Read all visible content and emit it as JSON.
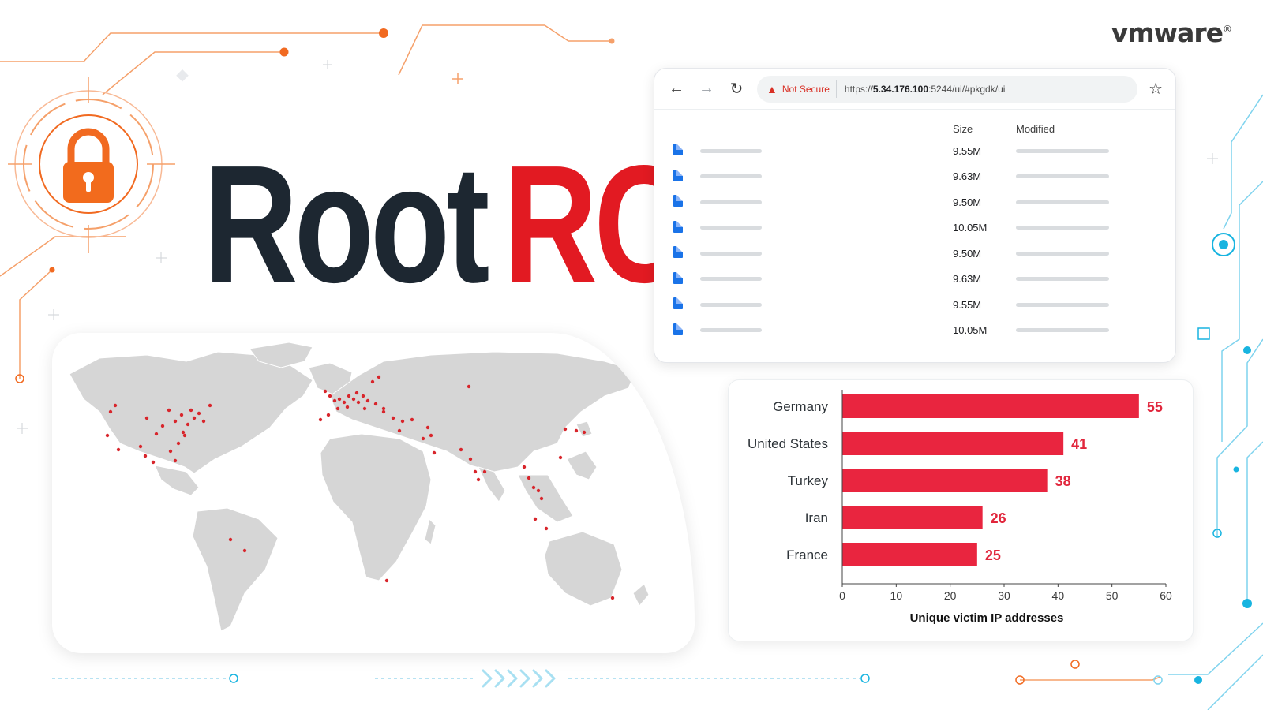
{
  "brand": {
    "logo_text": "vmware",
    "reg_mark": "®"
  },
  "headline": {
    "word1": "Root",
    "word2": "RCE"
  },
  "colors": {
    "accent_red": "#e21a22",
    "bar_red": "#e9253f",
    "dark": "#1d2731",
    "orange": "#f16a21",
    "cyan": "#18b4e0"
  },
  "icons": {
    "lock": "padlock-icon",
    "back": "arrow-left-icon",
    "forward": "arrow-right-icon",
    "reload": "reload-icon",
    "warning": "warning-triangle-icon",
    "bookmark": "star-icon",
    "file": "file-icon"
  },
  "browser": {
    "security_label": "Not Secure",
    "url_scheme": "https://",
    "url_host": "5.34.176.100",
    "url_rest": ":5244/ui/#pkgdk/ui",
    "columns": {
      "size": "Size",
      "modified": "Modified"
    },
    "files": [
      {
        "size": "9.55M"
      },
      {
        "size": "9.63M"
      },
      {
        "size": "9.50M"
      },
      {
        "size": "10.05M"
      },
      {
        "size": "9.50M"
      },
      {
        "size": "9.63M"
      },
      {
        "size": "9.55M"
      },
      {
        "size": "10.05M"
      }
    ]
  },
  "chart_data": {
    "type": "bar",
    "orientation": "horizontal",
    "categories": [
      "Germany",
      "United States",
      "Turkey",
      "Iran",
      "France"
    ],
    "values": [
      55,
      41,
      38,
      26,
      25
    ],
    "xlabel": "Unique victim IP addresses",
    "xlim": [
      0,
      60
    ],
    "xticks": [
      0,
      10,
      20,
      30,
      40,
      50,
      60
    ],
    "grid": false,
    "data_labels": true
  }
}
